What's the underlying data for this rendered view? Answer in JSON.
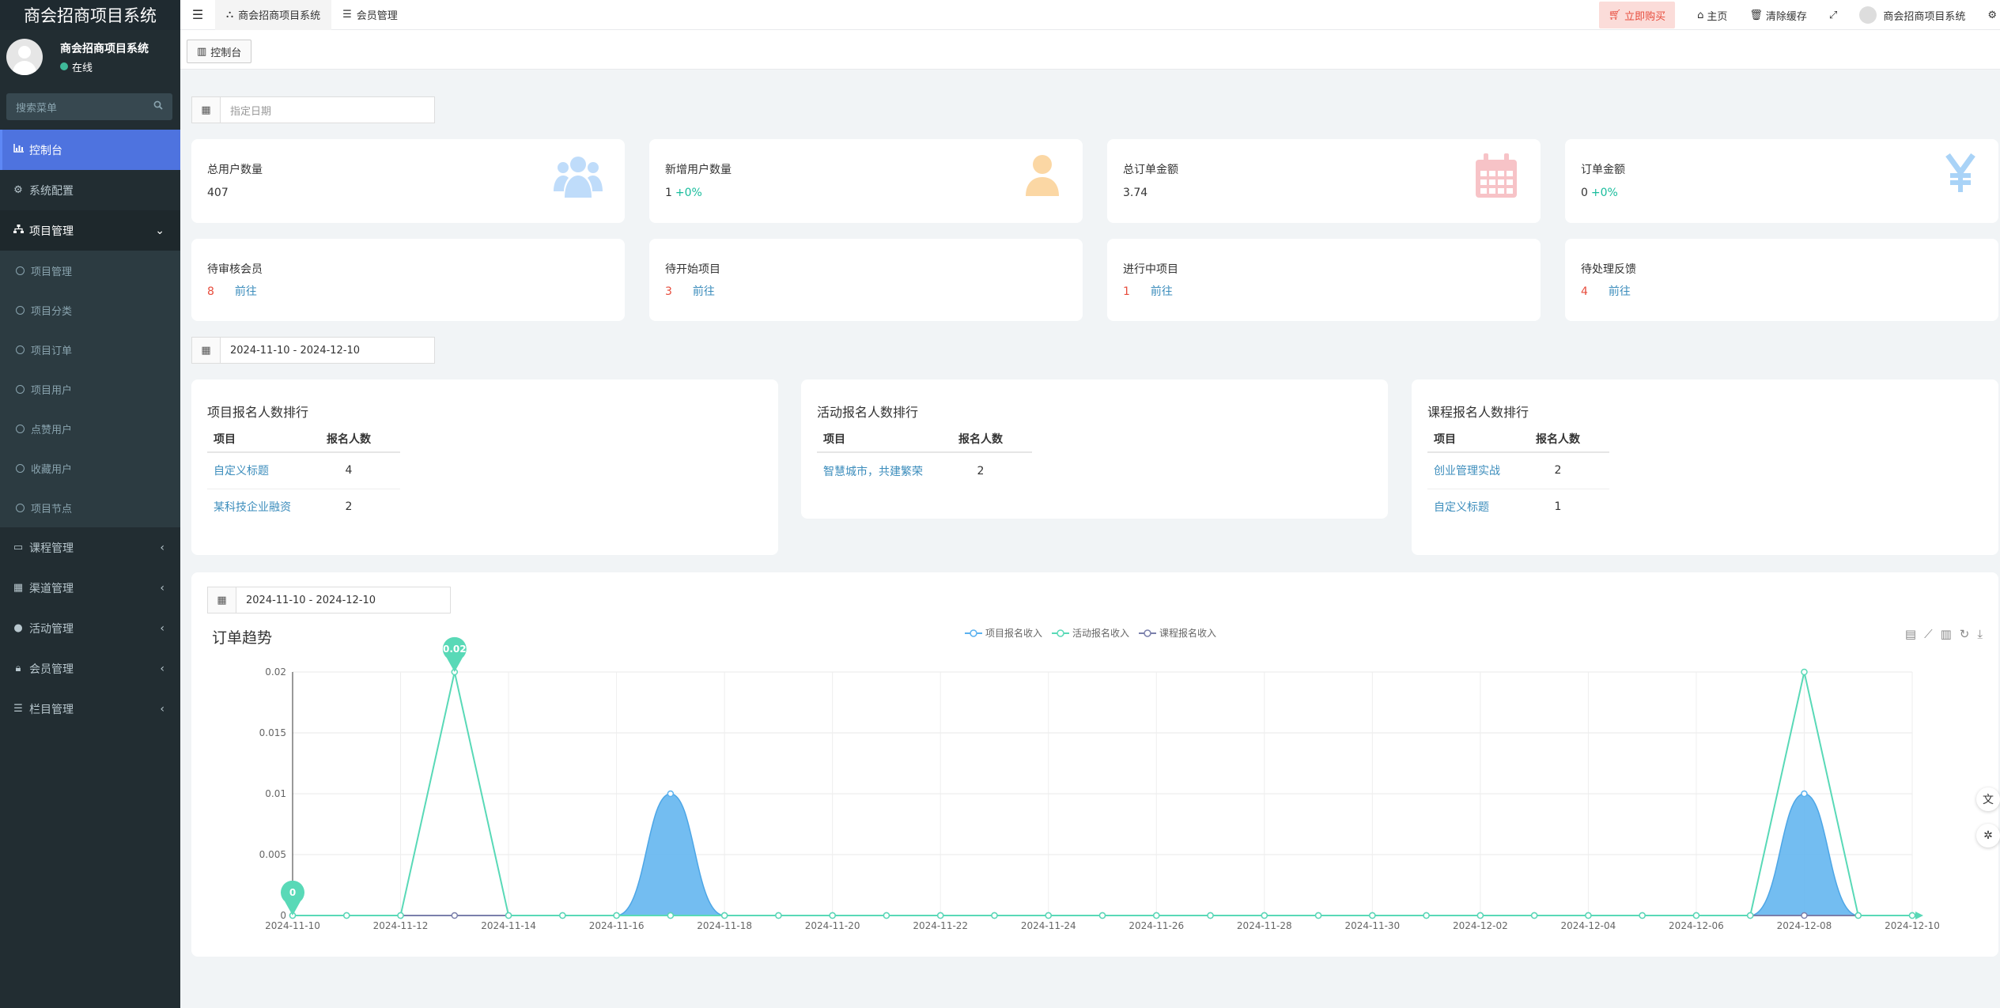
{
  "sidebar": {
    "logo": "商会招商项目系统",
    "user_name": "商会招商项目系统",
    "user_status": "在线",
    "search_placeholder": "搜索菜单",
    "items": [
      {
        "label": "控制台",
        "icon": "bar-chart-icon"
      },
      {
        "label": "系统配置",
        "icon": "cogs-icon"
      },
      {
        "label": "项目管理",
        "icon": "sitemap-icon"
      },
      {
        "label": "课程管理",
        "icon": "id-card-icon"
      },
      {
        "label": "渠道管理",
        "icon": "th-large-icon"
      },
      {
        "label": "活动管理",
        "icon": "info-circle-icon"
      },
      {
        "label": "会员管理",
        "icon": "lock-icon"
      },
      {
        "label": "栏目管理",
        "icon": "list-icon"
      }
    ],
    "sub_items": [
      "项目管理",
      "项目分类",
      "项目订单",
      "项目用户",
      "点赞用户",
      "收藏用户",
      "项目节点"
    ]
  },
  "topbar": {
    "tabs": [
      "商会招商项目系统",
      "会员管理"
    ],
    "buy": "立即购买",
    "home": "主页",
    "clear_cache": "清除缓存",
    "user": "商会招商项目系统"
  },
  "breadcrumb": "控制台",
  "filters": {
    "date_placeholder": "指定日期",
    "range1": "2024-11-10 - 2024-12-10",
    "range2": "2024-11-10 - 2024-12-10"
  },
  "stats": [
    {
      "title": "总用户数量",
      "value": "407",
      "pct": "",
      "icon": "users-icon",
      "color": "#bfdcfa"
    },
    {
      "title": "新增用户数量",
      "value": "1",
      "pct": "+0%",
      "icon": "user-icon",
      "color": "#fbd7a4"
    },
    {
      "title": "总订单金额",
      "value": "3.74",
      "pct": "",
      "icon": "calendar-icon",
      "color": "#f7c3c7"
    },
    {
      "title": "订单金额",
      "value": "0",
      "pct": "+0%",
      "icon": "yen-icon",
      "color": "#a9d3f7"
    }
  ],
  "todos": [
    {
      "title": "待审核会员",
      "num": "8",
      "link": "前往"
    },
    {
      "title": "待开始项目",
      "num": "3",
      "link": "前往"
    },
    {
      "title": "进行中项目",
      "num": "1",
      "link": "前往"
    },
    {
      "title": "待处理反馈",
      "num": "4",
      "link": "前往"
    }
  ],
  "rankings": [
    {
      "title": "项目报名人数排行",
      "col1": "项目",
      "col2": "报名人数",
      "rows": [
        {
          "name": "自定义标题",
          "count": "4"
        },
        {
          "name": "某科技企业融资",
          "count": "2"
        }
      ]
    },
    {
      "title": "活动报名人数排行",
      "col1": "项目",
      "col2": "报名人数",
      "rows": [
        {
          "name": "智慧城市，共建繁荣",
          "count": "2"
        }
      ]
    },
    {
      "title": "课程报名人数排行",
      "col1": "项目",
      "col2": "报名人数",
      "rows": [
        {
          "name": "创业管理实战",
          "count": "2"
        },
        {
          "name": "自定义标题",
          "count": "1"
        }
      ]
    }
  ],
  "chart_data": {
    "type": "line",
    "title": "订单趋势",
    "x": [
      "2024-11-10",
      "2024-11-11",
      "2024-11-12",
      "2024-11-13",
      "2024-11-14",
      "2024-11-15",
      "2024-11-16",
      "2024-11-17",
      "2024-11-18",
      "2024-11-19",
      "2024-11-20",
      "2024-11-21",
      "2024-11-22",
      "2024-11-23",
      "2024-11-24",
      "2024-11-25",
      "2024-11-26",
      "2024-11-27",
      "2024-11-28",
      "2024-11-29",
      "2024-11-30",
      "2024-12-01",
      "2024-12-02",
      "2024-12-03",
      "2024-12-04",
      "2024-12-05",
      "2024-12-06",
      "2024-12-07",
      "2024-12-08",
      "2024-12-09",
      "2024-12-10"
    ],
    "x_tick_labels": [
      "2024-11-10",
      "2024-11-12",
      "2024-11-14",
      "2024-11-16",
      "2024-11-18",
      "2024-11-20",
      "2024-11-22",
      "2024-11-24",
      "2024-11-26",
      "2024-11-28",
      "2024-11-30",
      "2024-12-02",
      "2024-12-04",
      "2024-12-06",
      "2024-12-08",
      "2024-12-10"
    ],
    "y_ticks": [
      "0",
      "0.005",
      "0.01",
      "0.015",
      "0.02"
    ],
    "ylim": [
      0,
      0.02
    ],
    "series": [
      {
        "name": "项目报名收入",
        "color": "#5ab1ef",
        "area": true,
        "smooth": true,
        "values": [
          0,
          0,
          0,
          0,
          0,
          0,
          0,
          0.01,
          0,
          0,
          0,
          0,
          0,
          0,
          0,
          0,
          0,
          0,
          0,
          0,
          0,
          0,
          0,
          0,
          0,
          0,
          0,
          0,
          0.01,
          0,
          0
        ]
      },
      {
        "name": "活动报名收入",
        "color": "#59d9b7",
        "area": false,
        "smooth": false,
        "values": [
          0,
          0,
          0,
          0.02,
          0,
          0,
          0,
          0,
          0,
          0,
          0,
          0,
          0,
          0,
          0,
          0,
          0,
          0,
          0,
          0,
          0,
          0,
          0,
          0,
          0,
          0,
          0,
          0,
          0.02,
          0,
          0
        ]
      },
      {
        "name": "课程报名收入",
        "color": "#7a7fab",
        "area": false,
        "smooth": false,
        "values": [
          0,
          0,
          0,
          0,
          0,
          0,
          0,
          0,
          0,
          0,
          0,
          0,
          0,
          0,
          0,
          0,
          0,
          0,
          0,
          0,
          0,
          0,
          0,
          0,
          0,
          0,
          0,
          0,
          0,
          0,
          0
        ]
      }
    ],
    "markpoints": [
      {
        "label": "0.02"
      },
      {
        "label": "0"
      }
    ],
    "legend_position": "top-center"
  }
}
